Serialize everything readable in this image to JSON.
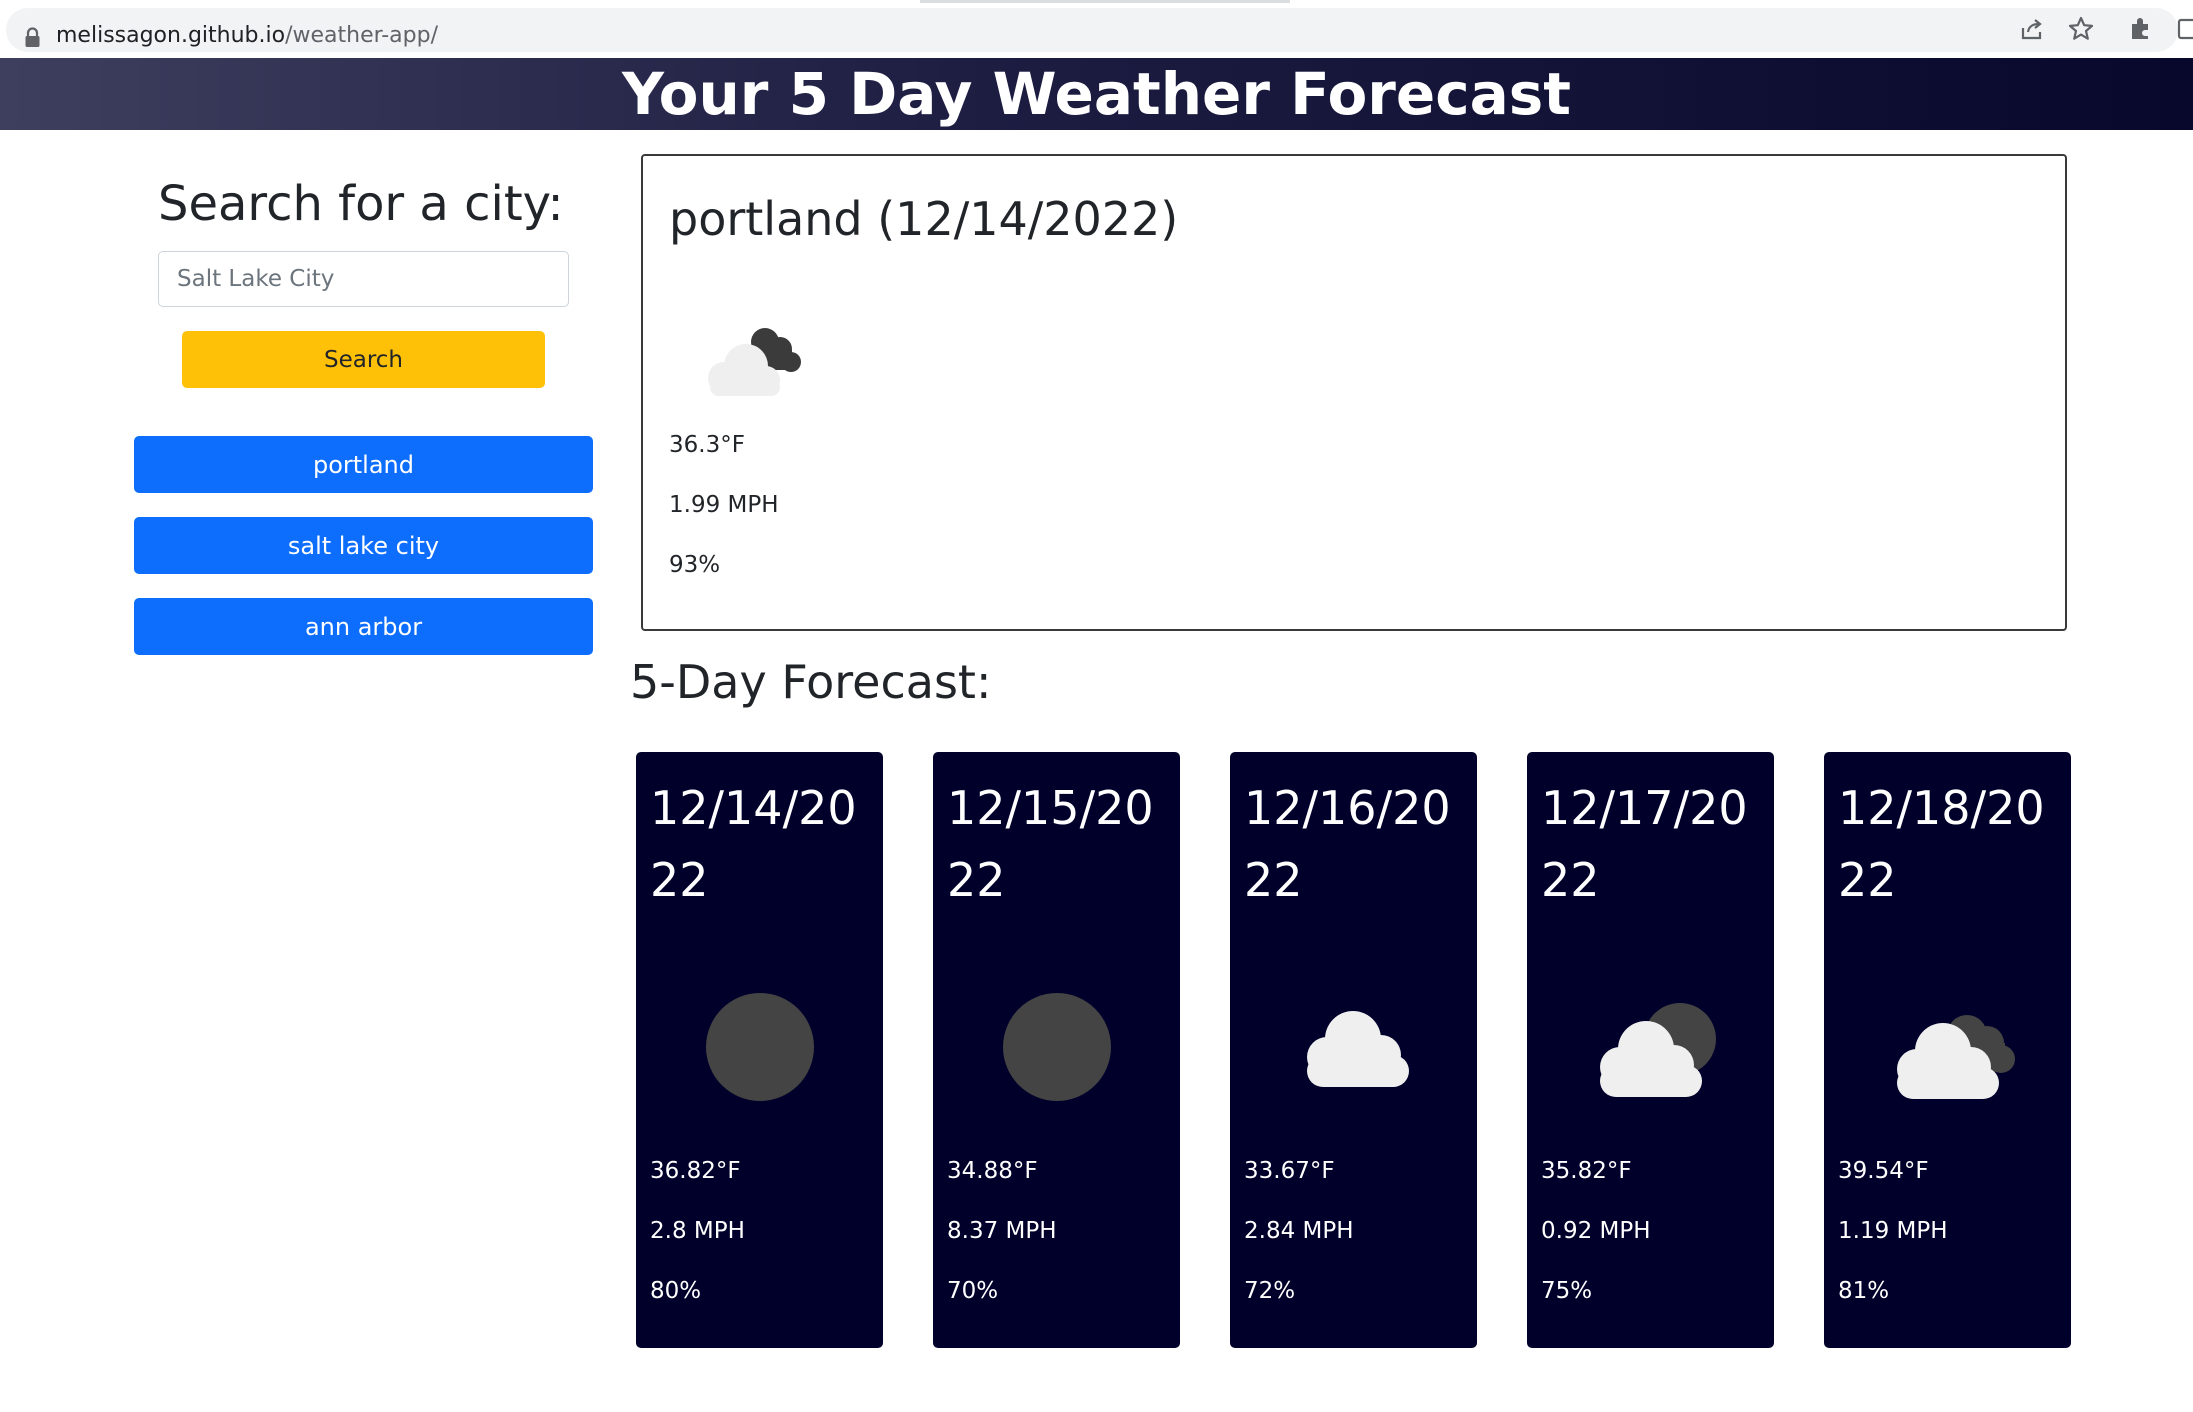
{
  "browser": {
    "url_host": "melissagon.github.io",
    "url_path": "/weather-app/"
  },
  "header": {
    "title": "Your 5 Day Weather Forecast"
  },
  "sidebar": {
    "heading": "Search for a city:",
    "search_placeholder": "Salt Lake City",
    "search_button": "Search",
    "history": [
      "portland",
      "salt lake city",
      "ann arbor"
    ]
  },
  "current": {
    "title": "portland (12/14/2022)",
    "icon": "broken-clouds-icon",
    "temp": "36.3°F",
    "wind": "1.99 MPH",
    "humidity": "93%"
  },
  "forecast": {
    "heading": "5-Day Forecast:",
    "days": [
      {
        "date": "12/14/2022",
        "icon": "clear-night-icon",
        "temp": "36.82°F",
        "wind": "2.8 MPH",
        "humidity": "80%"
      },
      {
        "date": "12/15/2022",
        "icon": "clear-night-icon",
        "temp": "34.88°F",
        "wind": "8.37 MPH",
        "humidity": "70%"
      },
      {
        "date": "12/16/2022",
        "icon": "cloud-icon",
        "temp": "33.67°F",
        "wind": "2.84 MPH",
        "humidity": "72%"
      },
      {
        "date": "12/17/2022",
        "icon": "partly-cloudy-night-icon",
        "temp": "35.82°F",
        "wind": "0.92 MPH",
        "humidity": "75%"
      },
      {
        "date": "12/18/2022",
        "icon": "broken-clouds-icon",
        "temp": "39.54°F",
        "wind": "1.19 MPH",
        "humidity": "81%"
      }
    ]
  },
  "colors": {
    "search_button": "#ffc107",
    "history_button": "#0d6efd",
    "forecast_card": "#01002a"
  }
}
